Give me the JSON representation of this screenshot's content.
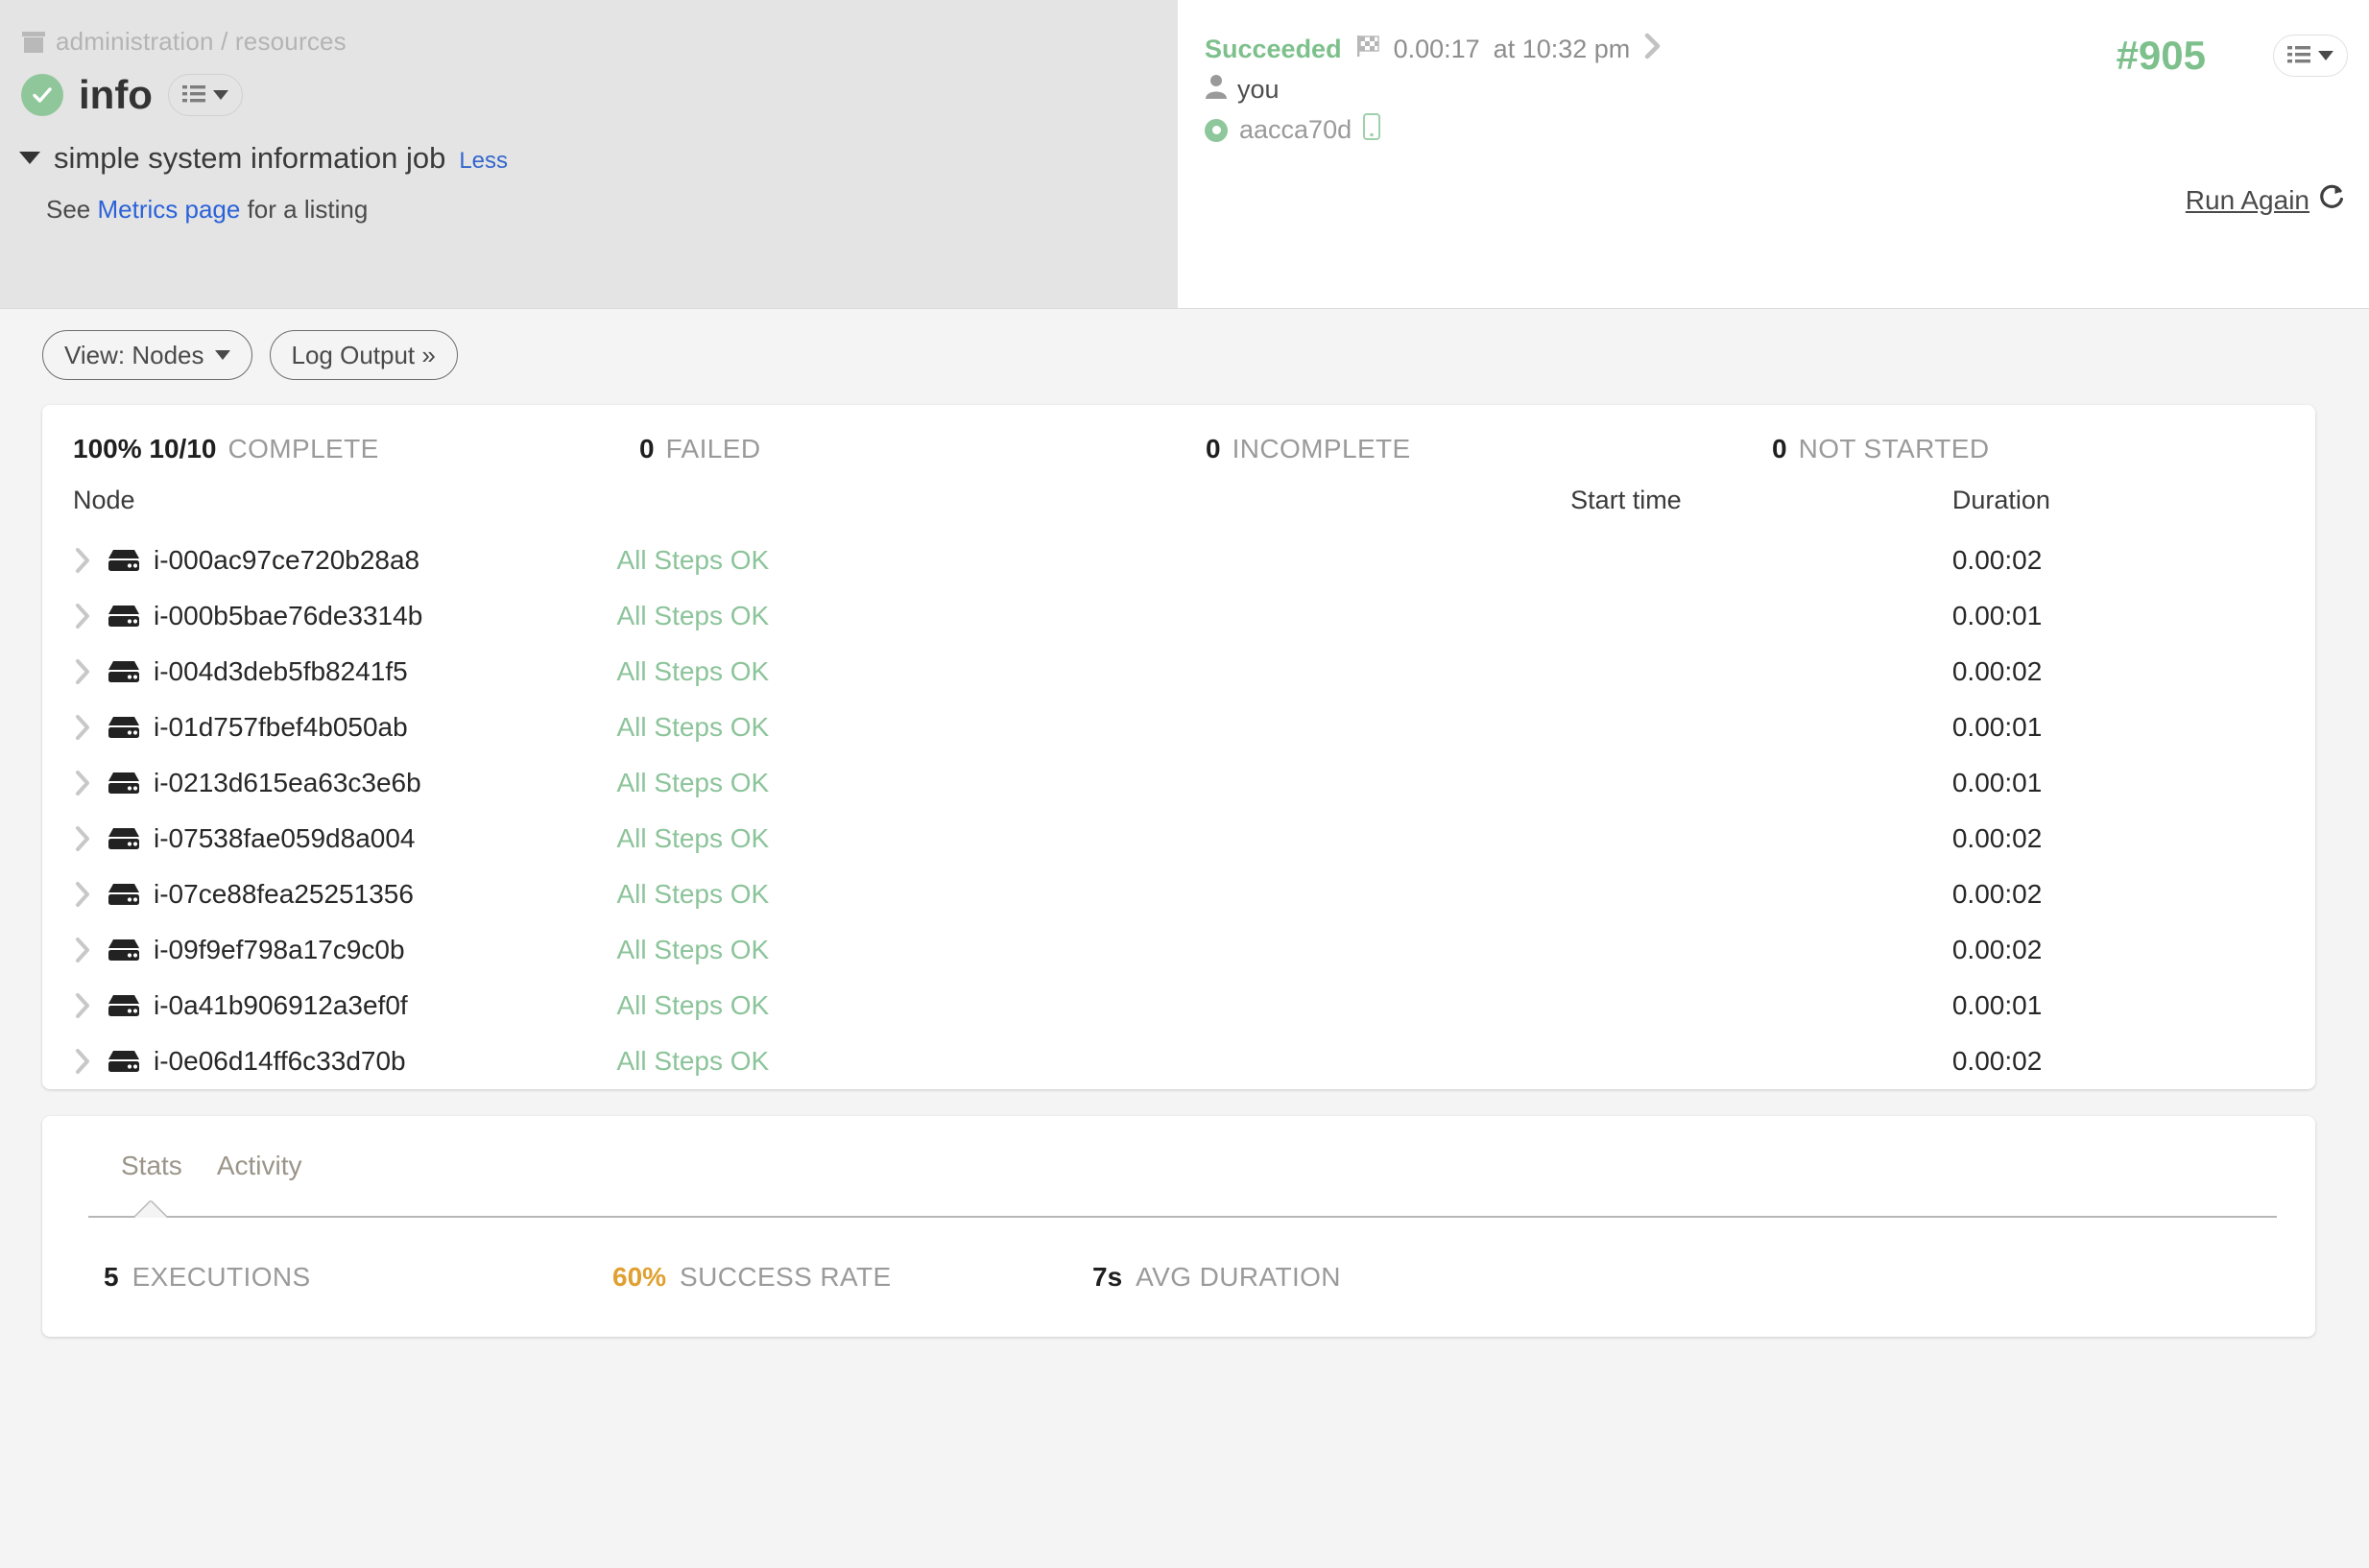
{
  "breadcrumb": {
    "text": "administration / resources"
  },
  "job": {
    "title": "info",
    "description_title": "simple system information job",
    "less_label": "Less",
    "description_prefix": "See ",
    "description_link": "Metrics page",
    "description_suffix": " for a listing"
  },
  "run": {
    "status": "Succeeded",
    "duration": "0.00:17",
    "at": "at 10:32 pm",
    "user": "you",
    "node": "aacca70d",
    "execution_id": "#905",
    "run_again_label": "Run Again"
  },
  "toolbar": {
    "view_label": "View: Nodes",
    "log_output_label": "Log Output »"
  },
  "summary": [
    {
      "num": "100% 10/10",
      "label": "COMPLETE"
    },
    {
      "num": "0",
      "label": "FAILED"
    },
    {
      "num": "0",
      "label": "INCOMPLETE"
    },
    {
      "num": "0",
      "label": "NOT STARTED"
    }
  ],
  "table": {
    "headers": {
      "node": "Node",
      "steps": "",
      "start_time": "Start time",
      "duration": "Duration"
    },
    "rows": [
      {
        "node": "i-000ac97ce720b28a8",
        "steps": "All Steps OK",
        "start_time": "",
        "duration": "0.00:02"
      },
      {
        "node": "i-000b5bae76de3314b",
        "steps": "All Steps OK",
        "start_time": "",
        "duration": "0.00:01"
      },
      {
        "node": "i-004d3deb5fb8241f5",
        "steps": "All Steps OK",
        "start_time": "",
        "duration": "0.00:02"
      },
      {
        "node": "i-01d757fbef4b050ab",
        "steps": "All Steps OK",
        "start_time": "",
        "duration": "0.00:01"
      },
      {
        "node": "i-0213d615ea63c3e6b",
        "steps": "All Steps OK",
        "start_time": "",
        "duration": "0.00:01"
      },
      {
        "node": "i-07538fae059d8a004",
        "steps": "All Steps OK",
        "start_time": "",
        "duration": "0.00:02"
      },
      {
        "node": "i-07ce88fea25251356",
        "steps": "All Steps OK",
        "start_time": "",
        "duration": "0.00:02"
      },
      {
        "node": "i-09f9ef798a17c9c0b",
        "steps": "All Steps OK",
        "start_time": "",
        "duration": "0.00:02"
      },
      {
        "node": "i-0a41b906912a3ef0f",
        "steps": "All Steps OK",
        "start_time": "",
        "duration": "0.00:01"
      },
      {
        "node": "i-0e06d14ff6c33d70b",
        "steps": "All Steps OK",
        "start_time": "",
        "duration": "0.00:02"
      }
    ]
  },
  "stats": {
    "tabs": [
      {
        "label": "Stats",
        "active": true
      },
      {
        "label": "Activity",
        "active": false
      }
    ],
    "metrics": [
      {
        "num": "5",
        "label": "EXECUTIONS",
        "warn": false
      },
      {
        "num": "60%",
        "label": "SUCCESS RATE",
        "warn": true
      },
      {
        "num": "7s",
        "label": "AVG DURATION",
        "warn": false
      }
    ]
  },
  "colors": {
    "success_green": "#8cc49a",
    "warn_orange": "#e0a030",
    "link_blue": "#2b62d9",
    "panel_gray": "#e4e4e4",
    "page_bg": "#f4f4f4"
  }
}
